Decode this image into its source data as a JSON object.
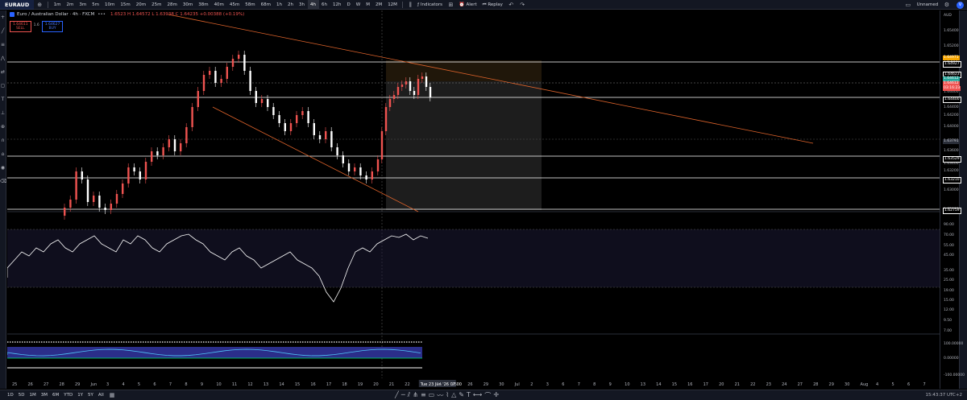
{
  "toolbar": {
    "symbol": "EURAUD",
    "timeframes": [
      "1m",
      "2m",
      "3m",
      "5m",
      "10m",
      "15m",
      "20m",
      "25m",
      "28m",
      "30m",
      "38m",
      "40m",
      "45m",
      "58m",
      "68m",
      "1h",
      "2h",
      "3h",
      "4h",
      "6h",
      "12h",
      "D",
      "W",
      "M",
      "2M",
      "12M"
    ],
    "active_timeframe": "4h",
    "indicators_label": "Indicators",
    "alert_label": "Alert",
    "replay_label": "Replay",
    "layout_name": "Unnamed",
    "avatar_letter": "V"
  },
  "legend": {
    "title": "Euro / Australian Dollar · 4h · FXCM",
    "ohlc": "1.6523 H 1.64572 L 1.63938 C 1.64235 +0.00388 (+0.19%)"
  },
  "trade": {
    "sell_price": "1.64611",
    "sell_label": "SELL",
    "spread": "1.6",
    "buy_price": "1.64627",
    "buy_label": "BUY"
  },
  "price_scale": {
    "currency": "AUD",
    "labels": [
      "1.65400",
      "1.65200",
      "1.65000",
      "1.64800",
      "1.64600",
      "1.64400",
      "1.64200",
      "1.64000",
      "1.63800",
      "1.63600",
      "1.63400",
      "1.63200",
      "1.63000",
      "1.62800"
    ],
    "tags": [
      {
        "text": "1.64971",
        "color": "#f7a600"
      },
      {
        "text": "1.64927",
        "color": "#ffffff"
      },
      {
        "text": "1.64623",
        "color": "#ffffff"
      },
      {
        "text": "1.64612",
        "color": "#26a69a"
      },
      {
        "text": "1.64612",
        "color": "#ef5350"
      },
      {
        "text": "03:16:23",
        "color": "#ef5350"
      },
      {
        "text": "1.64400",
        "color": "#ffffff"
      },
      {
        "text": "1.63791",
        "color": "#2a2e39"
      },
      {
        "text": "1.63529",
        "color": "#ffffff"
      },
      {
        "text": "1.63210",
        "color": "#ffffff"
      },
      {
        "text": "1.62759",
        "color": "#ffffff"
      }
    ],
    "rsi_labels": [
      "90.00",
      "70.00",
      "55.00",
      "45.00",
      "35.00",
      "25.00",
      "19.00",
      "15.00",
      "12.00",
      "9.50",
      "7.00"
    ],
    "osc_labels": [
      "100.00000",
      "0.00000",
      "-100.00000"
    ]
  },
  "time_axis": {
    "labels": [
      "25",
      "26",
      "27",
      "28",
      "29",
      "Jun",
      "3",
      "4",
      "5",
      "6",
      "7",
      "8",
      "9",
      "10",
      "11",
      "12",
      "13",
      "14",
      "15",
      "16",
      "17",
      "18",
      "19",
      "20",
      "21",
      "22",
      "Tue 23 Jun '26  07:00",
      "24",
      "25",
      "26",
      "29",
      "30",
      "Jul",
      "2",
      "3",
      "6",
      "7",
      "8",
      "9",
      "10",
      "13",
      "14",
      "15",
      "16",
      "17",
      "20",
      "21",
      "22",
      "23",
      "24",
      "27",
      "28",
      "29",
      "30",
      "Aug",
      "4",
      "5",
      "6",
      "7"
    ]
  },
  "bottom": {
    "ranges": [
      "1D",
      "5D",
      "1M",
      "3M",
      "6M",
      "YTD",
      "1Y",
      "5Y",
      "All"
    ],
    "clock": "15:43:37 UTC+2"
  },
  "colors": {
    "up": "#ef5350",
    "down": "#ffffff",
    "trendline": "#e0642b",
    "rsi": "#ffffff"
  }
}
